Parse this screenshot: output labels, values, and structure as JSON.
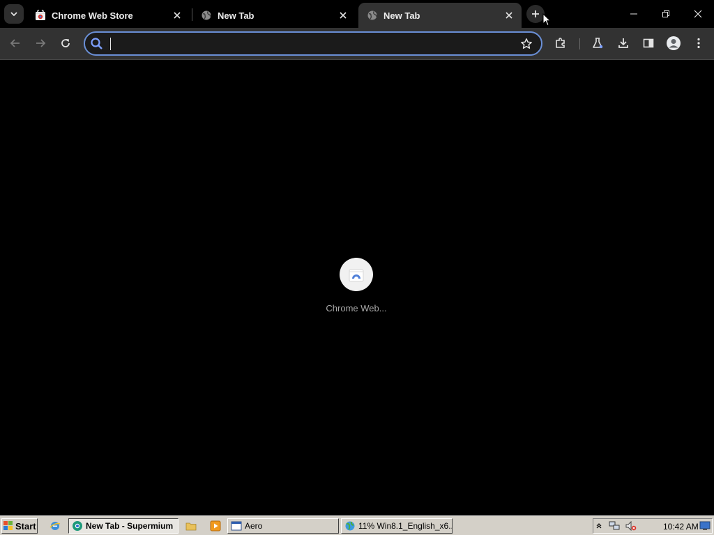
{
  "browser": {
    "tabs": [
      {
        "title": "Chrome Web Store",
        "favicon": "chrome-web-store-icon",
        "active": false
      },
      {
        "title": "New Tab",
        "favicon": "globe-icon",
        "active": false
      },
      {
        "title": "New Tab",
        "favicon": "globe-icon",
        "active": true
      }
    ],
    "omnibox": {
      "value": "",
      "placeholder": ""
    },
    "accent": "#6a8fd6"
  },
  "ntp": {
    "shortcuts": [
      {
        "label": "Chrome Web...",
        "icon": "chrome-web-store-icon"
      }
    ]
  },
  "taskbar": {
    "start_label": "Start",
    "tasks": [
      {
        "label": "New Tab - Supermium",
        "icon": "supermium-icon",
        "pressed": true
      },
      {
        "label": "Aero",
        "icon": "window-icon",
        "pressed": false
      },
      {
        "label": "11% Win8.1_English_x6...",
        "icon": "globe-download-icon",
        "pressed": false
      }
    ],
    "clock": "10:42 AM"
  }
}
